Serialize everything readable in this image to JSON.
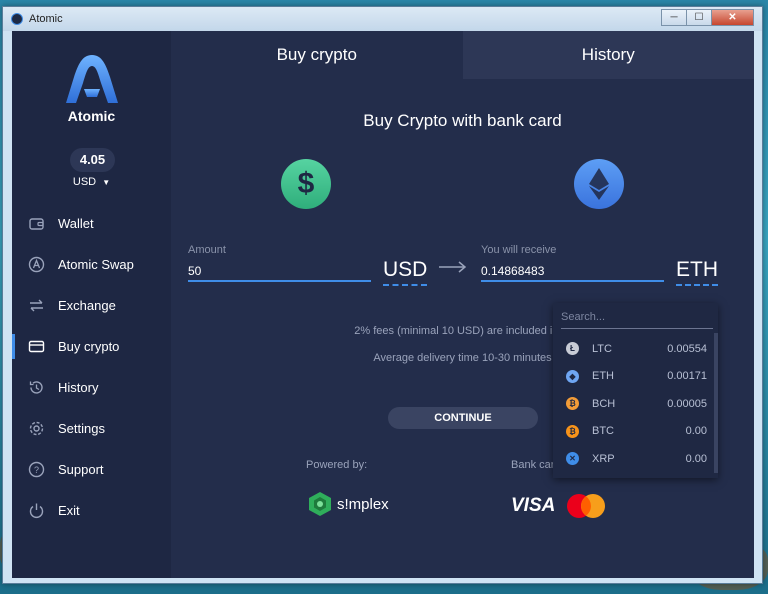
{
  "window": {
    "title": "Atomic",
    "minimize": "─",
    "maximize": "☐",
    "close": "✕"
  },
  "sidebar": {
    "logo_text": "Atomic",
    "balance": "4.05",
    "currency": "USD",
    "items": [
      {
        "label": "Wallet",
        "icon": "wallet-icon"
      },
      {
        "label": "Atomic Swap",
        "icon": "atomic-swap-icon"
      },
      {
        "label": "Exchange",
        "icon": "exchange-icon"
      },
      {
        "label": "Buy crypto",
        "icon": "card-icon",
        "active": true
      },
      {
        "label": "History",
        "icon": "history-icon"
      },
      {
        "label": "Settings",
        "icon": "gear-icon"
      },
      {
        "label": "Support",
        "icon": "help-icon"
      },
      {
        "label": "Exit",
        "icon": "power-icon"
      }
    ]
  },
  "tabs": {
    "buy": "Buy crypto",
    "history": "History"
  },
  "main": {
    "heading": "Buy Crypto with bank card",
    "amount_label": "Amount",
    "amount_value": "50",
    "amount_currency": "USD",
    "receive_label": "You will receive",
    "receive_value": "0.14868483",
    "receive_currency": "ETH",
    "fees_text": "2% fees (minimal 10 USD) are included in th",
    "delivery_text": "Average delivery time 10-30 minutes",
    "continue_label": "CONTINUE",
    "powered_by": "Powered by:",
    "bank_card": "Bank car",
    "simplex": "s!mplex",
    "visa": "VISA"
  },
  "dropdown": {
    "placeholder": "Search...",
    "items": [
      {
        "symbol": "LTC",
        "amount": "0.00554",
        "color": "#c8ccd6",
        "glyph": "Ł"
      },
      {
        "symbol": "ETH",
        "amount": "0.00171",
        "color": "#6fa6f2",
        "glyph": "◆"
      },
      {
        "symbol": "BCH",
        "amount": "0.00005",
        "color": "#f29c38",
        "glyph": "₿"
      },
      {
        "symbol": "BTC",
        "amount": "0.00",
        "color": "#f7931a",
        "glyph": "₿"
      },
      {
        "symbol": "XRP",
        "amount": "0.00",
        "color": "#3f8de8",
        "glyph": "✕"
      }
    ]
  },
  "colors": {
    "accent": "#3f8de8",
    "background": "#232d4b",
    "sidebar": "#1e2743"
  }
}
